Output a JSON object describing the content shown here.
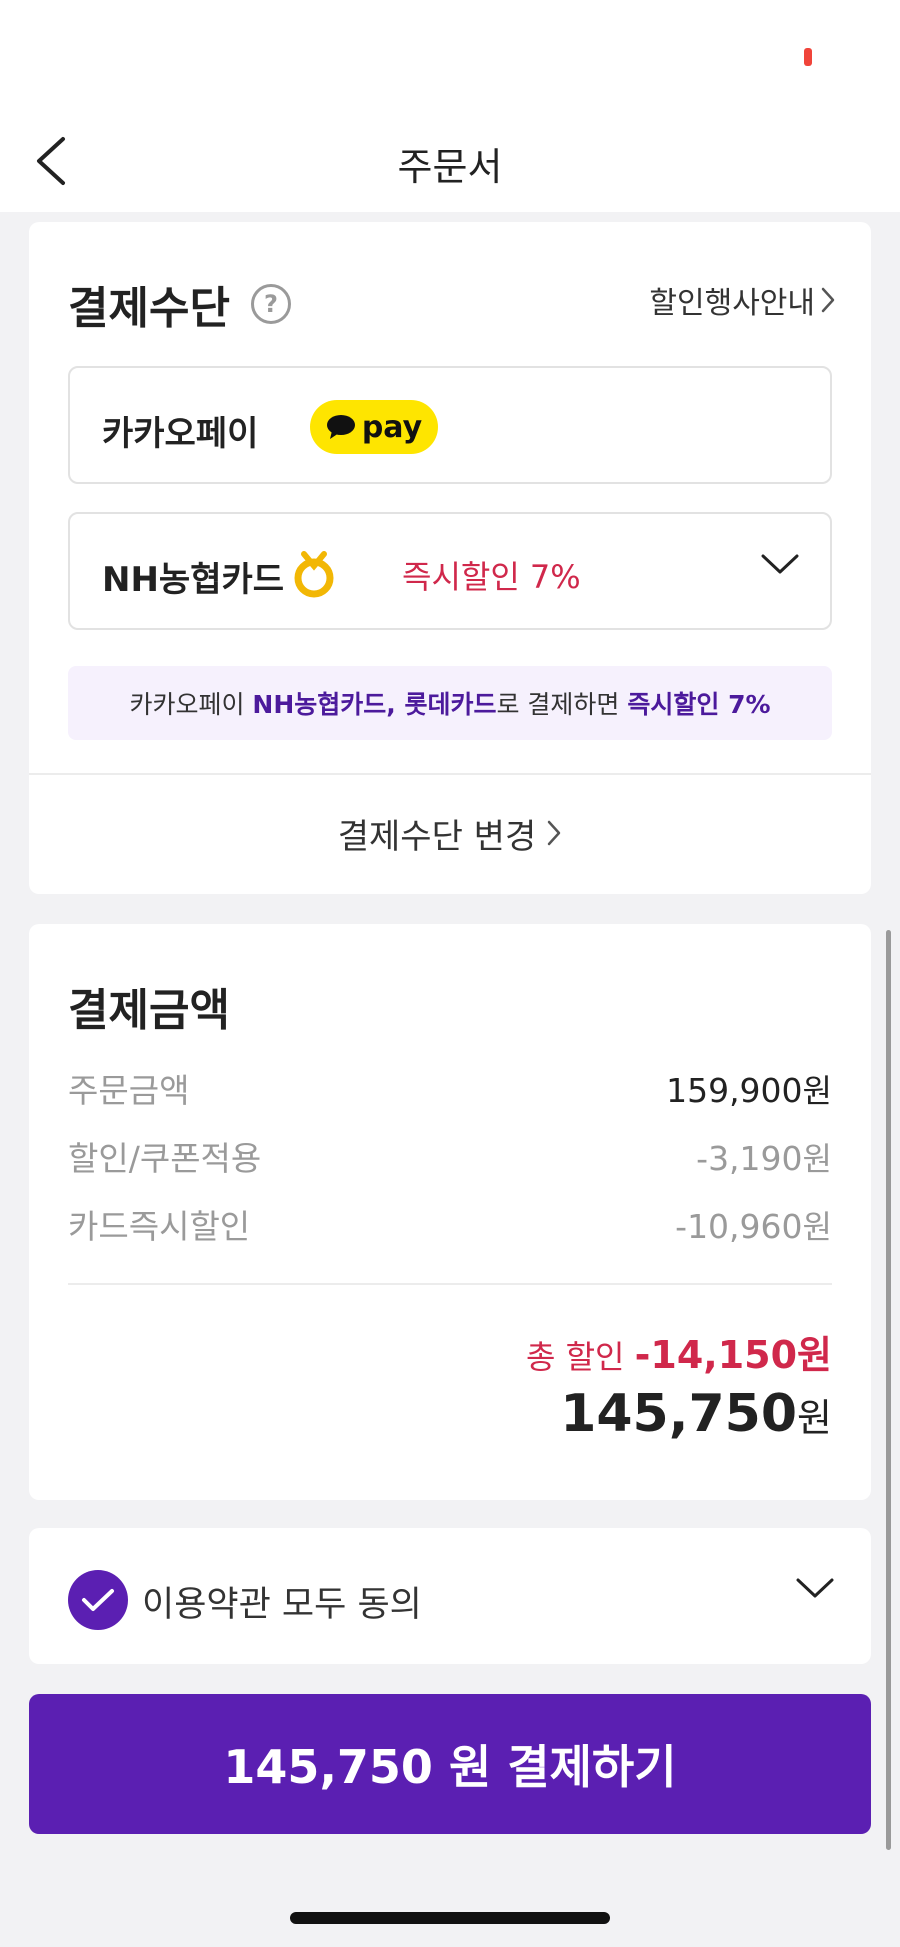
{
  "header": {
    "title": "주문서"
  },
  "payment": {
    "title": "결제수단",
    "help_symbol": "?",
    "promo_link": "할인행사안내",
    "kakao": {
      "label": "카카오페이",
      "badge": "pay"
    },
    "card": {
      "name": "NH농협카드",
      "discount": "즉시할인 7%"
    },
    "banner": {
      "prefix": "카카오페이 ",
      "cards": "NH농협카드, 롯데카드",
      "middle": "로 결제하면 ",
      "highlight": "즉시할인 7%"
    },
    "change_label": "결제수단 변경"
  },
  "amount": {
    "title": "결제금액",
    "unit": "원",
    "rows": [
      {
        "label": "주문금액",
        "value": "159,900"
      },
      {
        "label": "할인/쿠폰적용",
        "value": "-3,190"
      },
      {
        "label": "카드즉시할인",
        "value": "-10,960"
      }
    ],
    "total_discount_label": "총 할인",
    "total_discount_value": "-14,150원",
    "final_value": "145,750"
  },
  "terms": {
    "label": "이용약관 모두 동의"
  },
  "pay_button": {
    "label": "145,750 원 결제하기"
  },
  "colors": {
    "accent": "#5b1fb2",
    "discount_red": "#d0284b",
    "kakao_yellow": "#fee500"
  }
}
